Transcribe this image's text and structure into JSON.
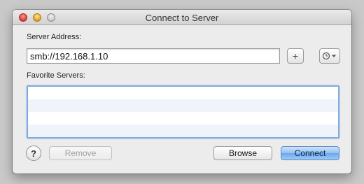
{
  "window": {
    "title": "Connect to Server",
    "accent_color": "#7fa9e0"
  },
  "server_address": {
    "label": "Server Address:",
    "value": "smb://192.168.1.10",
    "add_button_label": "+"
  },
  "favorites": {
    "label": "Favorite Servers:",
    "items": []
  },
  "footer": {
    "help_label": "?",
    "remove_label": "Remove",
    "browse_label": "Browse",
    "connect_label": "Connect"
  },
  "icons": {
    "close": "close-icon",
    "minimize": "minimize-icon",
    "zoom": "zoom-icon",
    "history": "clock-icon"
  }
}
